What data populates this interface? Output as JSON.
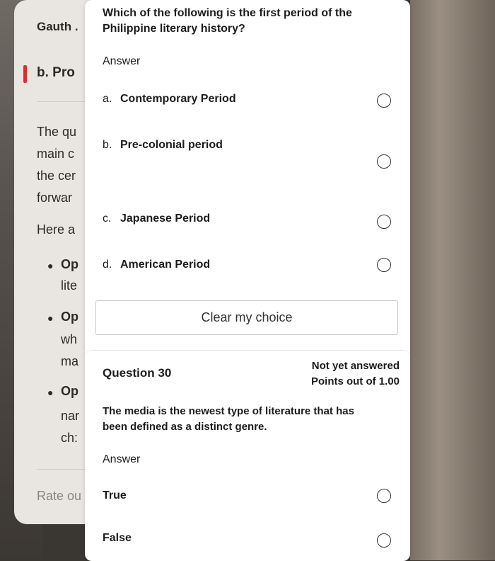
{
  "gauth": {
    "title": "Gauth .",
    "answer_heading": "b. Pro",
    "para_lines": [
      "The qu",
      "main c",
      "the cer",
      "forwar"
    ],
    "here": "Here a",
    "bullets": [
      "Op",
      "lite",
      "Op",
      "wh",
      "ma",
      "Op",
      "nar",
      "ch:"
    ],
    "rate": "Rate ou"
  },
  "question29": {
    "text_line1": "Which of the following is the first period of the",
    "text_line2": "Philippine literary history?",
    "answer_label": "Answer",
    "options": [
      {
        "letter": "a.",
        "label": "Contemporary Period"
      },
      {
        "letter": "b.",
        "label": "Pre-colonial period"
      },
      {
        "letter": "c.",
        "label": "Japanese Period"
      },
      {
        "letter": "d.",
        "label": "American Period"
      }
    ],
    "clear_choice": "Clear my choice"
  },
  "question30": {
    "title": "Question 30",
    "status": "Not yet answered",
    "points": "Points out of 1.00",
    "text_line1": "The media is the newest type of literature that has",
    "text_line2": "been defined as a distinct genre.",
    "answer_label": "Answer",
    "options": [
      {
        "label": "True"
      },
      {
        "label": "False"
      }
    ]
  }
}
